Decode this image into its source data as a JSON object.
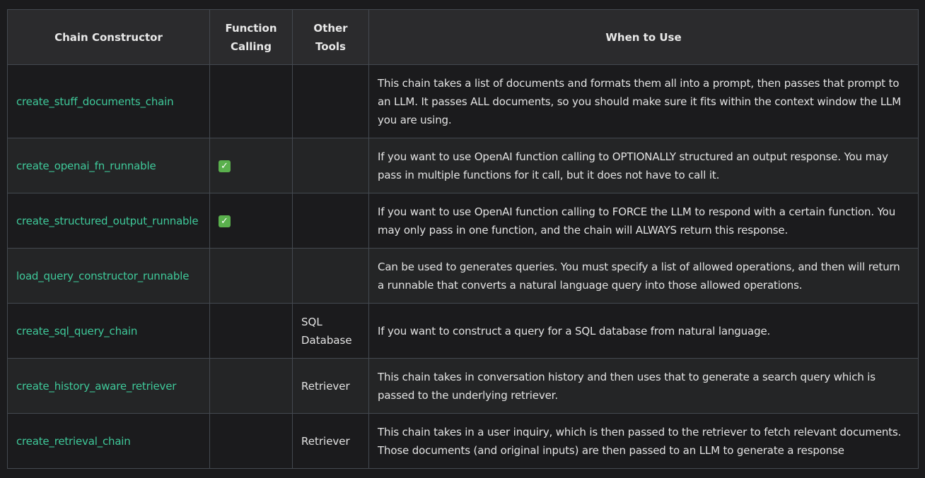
{
  "table": {
    "headers": [
      "Chain Constructor",
      "Function Calling",
      "Other Tools",
      "When to Use"
    ],
    "check_symbol": "✓",
    "rows": [
      {
        "constructor": "create_stuff_documents_chain",
        "function_calling": false,
        "other_tools": "",
        "when_to_use": "This chain takes a list of documents and formats them all into a prompt, then passes that prompt to an LLM. It passes ALL documents, so you should make sure it fits within the context window the LLM you are using."
      },
      {
        "constructor": "create_openai_fn_runnable",
        "function_calling": true,
        "other_tools": "",
        "when_to_use": "If you want to use OpenAI function calling to OPTIONALLY structured an output response. You may pass in multiple functions for it call, but it does not have to call it."
      },
      {
        "constructor": "create_structured_output_runnable",
        "function_calling": true,
        "other_tools": "",
        "when_to_use": "If you want to use OpenAI function calling to FORCE the LLM to respond with a certain function. You may only pass in one function, and the chain will ALWAYS return this response."
      },
      {
        "constructor": "load_query_constructor_runnable",
        "function_calling": false,
        "other_tools": "",
        "when_to_use": "Can be used to generates queries. You must specify a list of allowed operations, and then will return a runnable that converts a natural language query into those allowed operations."
      },
      {
        "constructor": "create_sql_query_chain",
        "function_calling": false,
        "other_tools": "SQL Database",
        "when_to_use": "If you want to construct a query for a SQL database from natural language."
      },
      {
        "constructor": "create_history_aware_retriever",
        "function_calling": false,
        "other_tools": "Retriever",
        "when_to_use": "This chain takes in conversation history and then uses that to generate a search query which is passed to the underlying retriever."
      },
      {
        "constructor": "create_retrieval_chain",
        "function_calling": false,
        "other_tools": "Retriever",
        "when_to_use": "This chain takes in a user inquiry, which is then passed to the retriever to fetch relevant documents. Those documents (and original inputs) are then passed to an LLM to generate a response"
      }
    ],
    "colors": {
      "page_background": "#1b1b1d",
      "header_background": "#2b2b2d",
      "alt_row_background": "#242526",
      "border": "#444950",
      "code_text": "#3fc99a",
      "check_green": "#5ab04d"
    }
  }
}
